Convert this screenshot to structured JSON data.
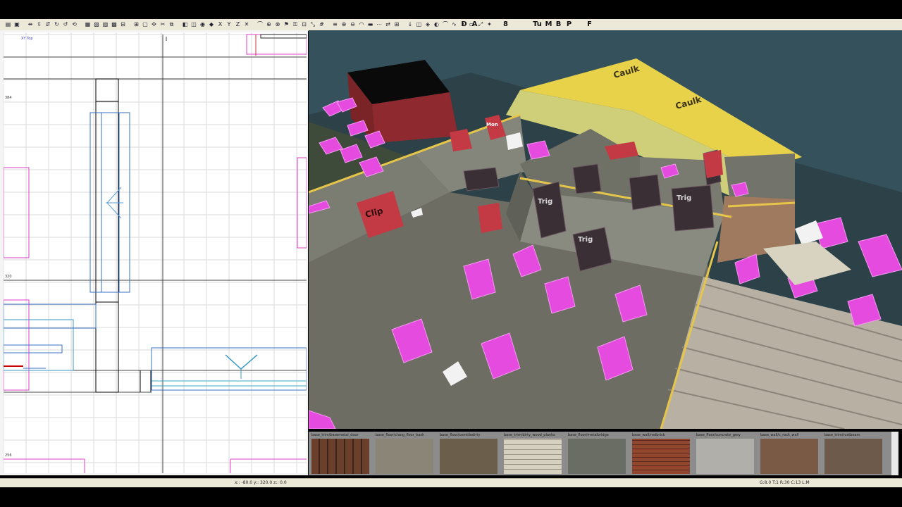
{
  "toolbar": {
    "items": [
      {
        "name": "open-icon"
      },
      {
        "name": "save-icon"
      },
      {
        "name": "flip-x-icon"
      },
      {
        "name": "flip-y-icon"
      },
      {
        "name": "flip-z-icon"
      },
      {
        "name": "rotate-x-icon"
      },
      {
        "name": "rotate-y-icon"
      },
      {
        "name": "rotate-z-icon"
      },
      {
        "name": "select-complete-tall-icon"
      },
      {
        "name": "select-touching-icon"
      },
      {
        "name": "select-partial-tall-icon"
      },
      {
        "name": "select-inside-icon"
      },
      {
        "name": "csg-subtract-icon"
      },
      {
        "name": "csg-merge-icon"
      },
      {
        "name": "hollow-icon"
      },
      {
        "name": "csg-tool-icon"
      },
      {
        "name": "clipper-icon"
      },
      {
        "name": "change-views-icon"
      },
      {
        "name": "texture-view-icon"
      },
      {
        "name": "cubic-clip-icon"
      },
      {
        "name": "camera-icon"
      },
      {
        "name": "entity-icon"
      },
      {
        "name": "view-xy-icon"
      },
      {
        "name": "view-xz-icon"
      },
      {
        "name": "view-yz-icon"
      },
      {
        "name": "patch-icon"
      },
      {
        "name": "patch-bend-icon"
      },
      {
        "name": "patch-weld-icon"
      },
      {
        "name": "drill-icon"
      },
      {
        "name": "filter-icon"
      },
      {
        "name": "lock-icon"
      },
      {
        "name": "texture-lock-icon"
      },
      {
        "name": "scale-icon"
      },
      {
        "name": "grid-icon"
      },
      {
        "name": "show-names-icon"
      },
      {
        "name": "patch-insert-icon"
      },
      {
        "name": "patch-delete-icon"
      },
      {
        "name": "cap-icon"
      },
      {
        "name": "thicken-icon"
      },
      {
        "name": "redisperse-icon"
      },
      {
        "name": "invert-icon"
      },
      {
        "name": "matrix-icon"
      },
      {
        "name": "down-arrow-icon"
      },
      {
        "name": "overlay-icon"
      },
      {
        "name": "view-entity-icon"
      },
      {
        "name": "monochrome-icon"
      },
      {
        "name": "bend-icon"
      },
      {
        "name": "curve-icon"
      },
      {
        "name": "vertex-icon"
      },
      {
        "name": "brush-icon"
      },
      {
        "name": "fit-icon"
      },
      {
        "name": "cull-icon"
      }
    ],
    "letters": [
      {
        "name": "letter-d-icon",
        "text": "D"
      },
      {
        "name": "letter-a-icon",
        "text": "A"
      },
      {
        "name": "letter-b-icon",
        "text": "8"
      },
      {
        "name": "letter-u-icon",
        "text": "Tu"
      },
      {
        "name": "letter-m-icon",
        "text": "M"
      },
      {
        "name": "letter-b2-icon",
        "text": "B"
      },
      {
        "name": "letter-p-icon",
        "text": "P"
      },
      {
        "name": "letter-f-icon",
        "text": "F"
      }
    ]
  },
  "view2d": {
    "title": "XY Top",
    "coords": [
      "384",
      "320",
      "256"
    ]
  },
  "viewport3d": {
    "texts": [
      "Caulk",
      "Trig",
      "Clip",
      "Mon"
    ]
  },
  "texture_browser": {
    "labels": [
      "base_trim/basemetal_door",
      "base_floor/clang_floor_bash",
      "base_floor/cemtiledirty",
      "base_trim/dirty_wood_planks",
      "base_floor/metalbridge",
      "base_wall/redbrick",
      "base_floor/concrete_grey",
      "base_wall/c_rock_wall",
      "base_trim/rustbeam"
    ]
  },
  "status": {
    "coords": "x:: -80.0  y:: 320.0  z:: 0.0",
    "grid": "G:8.0 T:1 R:30 C:13 L:M"
  }
}
